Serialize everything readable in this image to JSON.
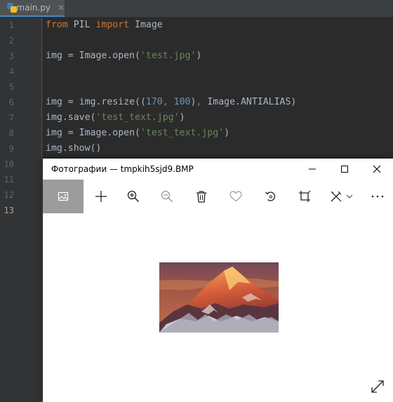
{
  "editor": {
    "tab": {
      "filename": "main.py",
      "close_glyph": "✕"
    },
    "current_line": 13,
    "line_numbers": [
      "1",
      "2",
      "3",
      "4",
      "5",
      "6",
      "7",
      "8",
      "9",
      "10",
      "11",
      "12",
      "13"
    ],
    "code": {
      "l1": {
        "kw1": "from",
        "mod": " PIL ",
        "kw2": "import",
        "name": " Image"
      },
      "l3": {
        "pre": "img = Image.open(",
        "str": "'test.jpg'",
        "post": ")"
      },
      "l6": {
        "pre": "img = img.resize((",
        "n1": "170",
        "sep": ", ",
        "n2": "100",
        "mid": ")",
        "comma": ",",
        "post": " Image.ANTIALIAS)"
      },
      "l7": {
        "pre": "img.save(",
        "str": "'test_text.jpg'",
        "post": ")"
      },
      "l8": {
        "pre": "img = Image.open(",
        "str": "'test_text.jpg'",
        "post": ")"
      },
      "l9": {
        "text": "img.show()"
      }
    }
  },
  "photos_window": {
    "title": "Фотографии — tmpkih5sjd9.BMP",
    "toolbar_icons": [
      "image-icon",
      "plus-icon",
      "zoom-in-icon",
      "zoom-out-icon",
      "delete-icon",
      "heart-icon",
      "rotate-icon",
      "crop-icon",
      "edit-icon",
      "chevron-down-icon",
      "more-icon"
    ],
    "window_buttons": [
      "minimize-icon",
      "maximize-icon",
      "close-icon"
    ],
    "image": {
      "description": "mountain"
    }
  }
}
